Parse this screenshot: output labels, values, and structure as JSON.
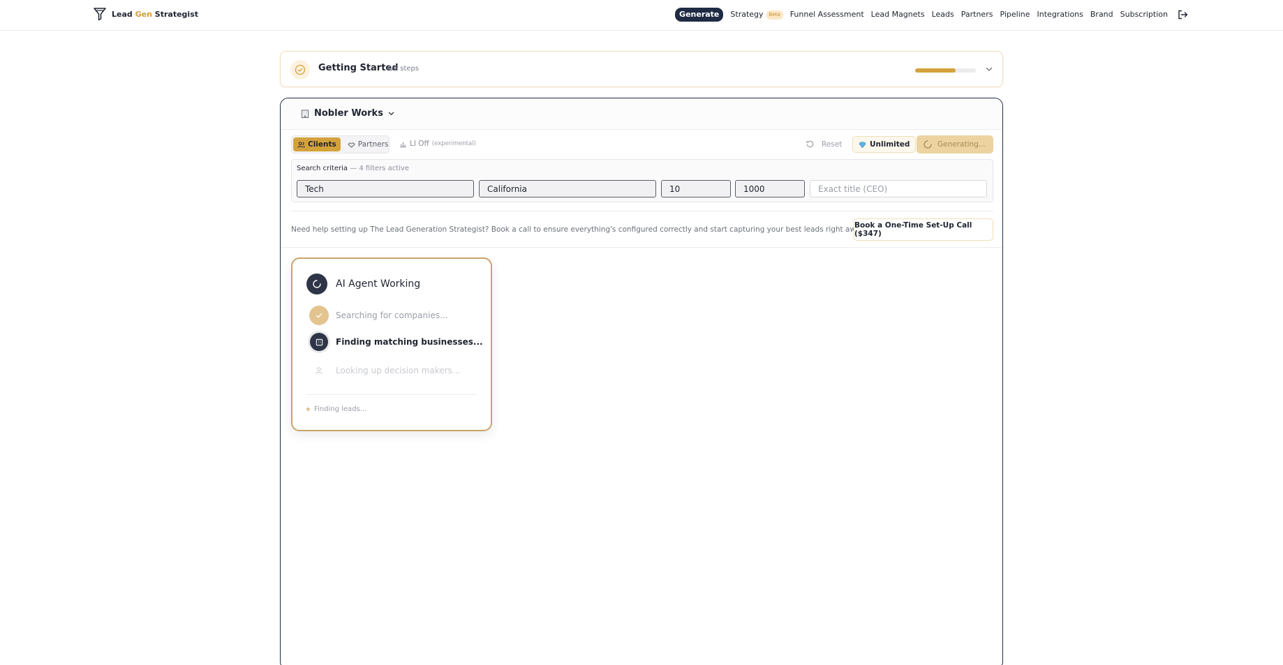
{
  "nav": {
    "brand_lead": "Lead",
    "brand_gen": "Gen",
    "brand_strategist": "Strategist",
    "links": [
      {
        "label": "Generate",
        "active": true
      },
      {
        "label": "Strategy",
        "badge": "Beta"
      },
      {
        "label": "Funnel Assessment"
      },
      {
        "label": "Lead Magnets"
      },
      {
        "label": "Leads"
      },
      {
        "label": "Partners"
      },
      {
        "label": "Pipeline"
      },
      {
        "label": "Integrations"
      },
      {
        "label": "Brand"
      },
      {
        "label": "Subscription"
      }
    ],
    "logout_icon": "logout-icon"
  },
  "getting_started": {
    "title": "Getting Started",
    "steps": "4/6 steps",
    "progress": 0.667
  },
  "workspace": {
    "name": "Nobler Works"
  },
  "toolbar": {
    "clients": "Clients",
    "partners": "Partners",
    "li_off": "LI Off",
    "experimental": "(experimental)",
    "reset": "Reset",
    "unlimited": "Unlimited",
    "generating": "Generating..."
  },
  "criteria": {
    "label": "Search criteria",
    "active": "— 4 filters active",
    "fields": {
      "industry": "Tech",
      "location": "California",
      "min_size": "10",
      "max_size": "1000",
      "title_placeholder": "Exact title (CEO)"
    }
  },
  "help": {
    "text": "Need help setting up The Lead Generation Strategist? Book a call to ensure everything's configured correctly and start capturing your best leads right away.",
    "button": "Book a One-Time Set-Up Call ($347)"
  },
  "agent": {
    "title": "AI Agent Working",
    "steps": [
      {
        "label": "Searching for companies...",
        "state": "done"
      },
      {
        "label": "Finding matching businesses...",
        "state": "active"
      },
      {
        "label": "Looking up decision makers...",
        "state": "pending"
      }
    ],
    "footer": "Finding leads..."
  },
  "colors": {
    "accent": "#d4a23c",
    "navy": "#1f2a44",
    "muted": "#9a9ea8"
  }
}
